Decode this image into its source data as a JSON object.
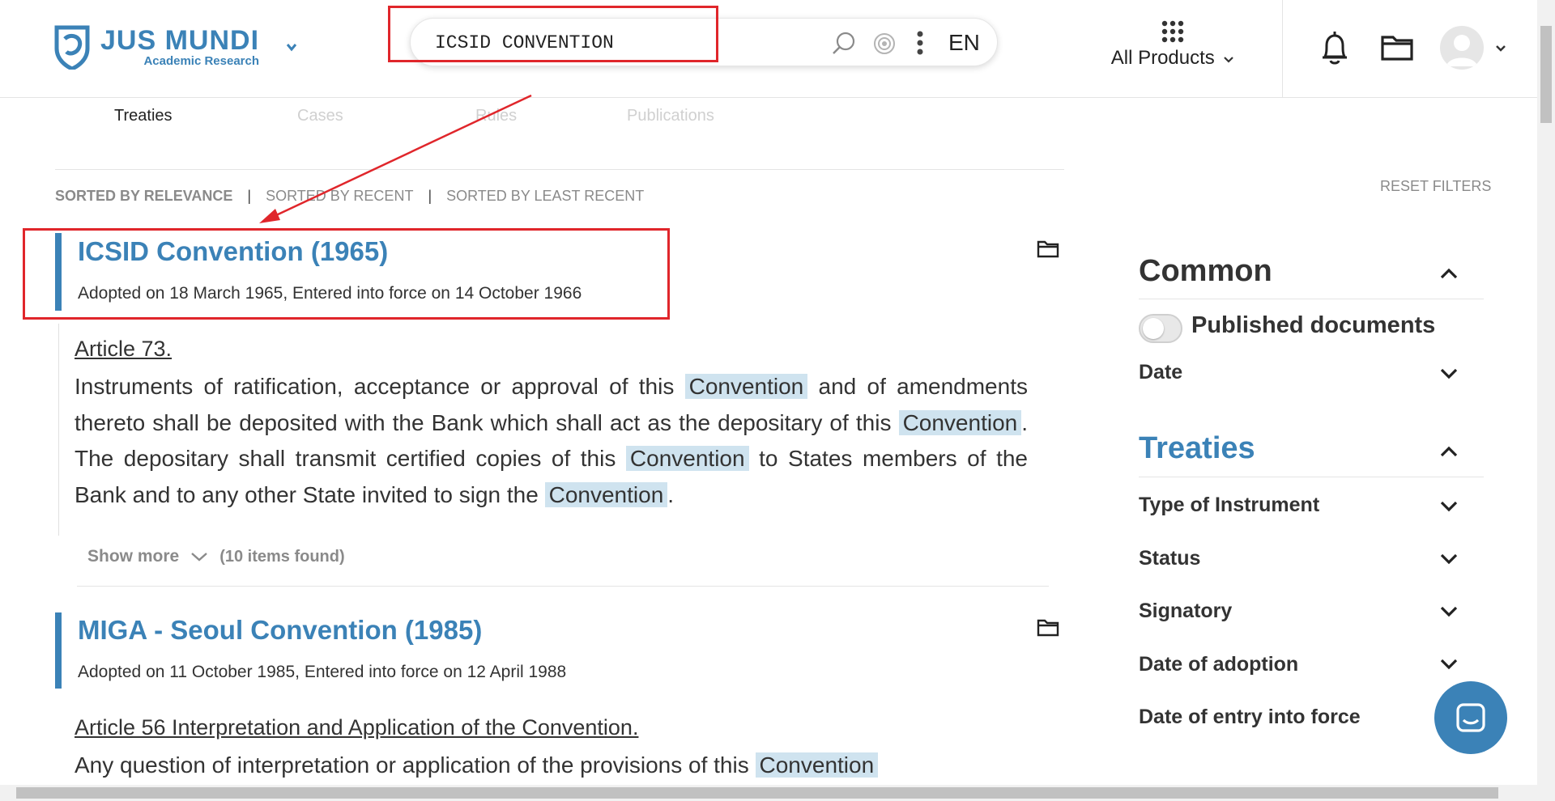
{
  "header": {
    "logo_name": "JUS MUNDI",
    "logo_sub": "Academic Research",
    "search_value": "ICSID CONVENTION",
    "language": "EN",
    "products_label": "All Products"
  },
  "tabs": [
    {
      "label": "Treaties",
      "active": true
    },
    {
      "label": "Cases",
      "active": false
    },
    {
      "label": "Rules",
      "active": false
    },
    {
      "label": "Publications",
      "active": false
    }
  ],
  "sort": {
    "relevance": "SORTED BY RELEVANCE",
    "recent": "SORTED BY RECENT",
    "least_recent": "SORTED BY LEAST RECENT",
    "separator": "|"
  },
  "results": [
    {
      "title": "ICSID Convention (1965)",
      "meta": "Adopted on 18 March 1965, Entered into force on 14 October 1966",
      "article": "Article 73.",
      "snippet": [
        "Instruments of ratification, acceptance or approval of this ",
        "Convention",
        " and of amendments thereto shall be deposited with the Bank which shall act as the depositary of this ",
        "Convention",
        ". The depositary shall transmit certified copies of this ",
        "Convention",
        " to States members of the Bank and to any other State invited to sign the ",
        "Convention",
        "."
      ],
      "show_more": "Show more",
      "items_found": "(10 items found)"
    },
    {
      "title": "MIGA - Seoul Convention (1985)",
      "meta": "Adopted on 11 October 1985, Entered into force on 12 April 1988",
      "article": "Article 56 Interpretation and Application of the Convention.",
      "snippet": [
        "Any question of interpretation or application of the provisions of this ",
        "Convention"
      ]
    }
  ],
  "filters": {
    "reset": "RESET FILTERS",
    "common_title": "Common",
    "published_documents": "Published documents",
    "date": "Date",
    "treaties_title": "Treaties",
    "type_of_instrument": "Type of Instrument",
    "status": "Status",
    "signatory": "Signatory",
    "date_of_adoption": "Date of adoption",
    "date_of_entry": "Date of entry into force"
  },
  "colors": {
    "brand_blue": "#3b82b7",
    "highlight": "#cfe3ef",
    "annotation_red": "#e0262b"
  }
}
